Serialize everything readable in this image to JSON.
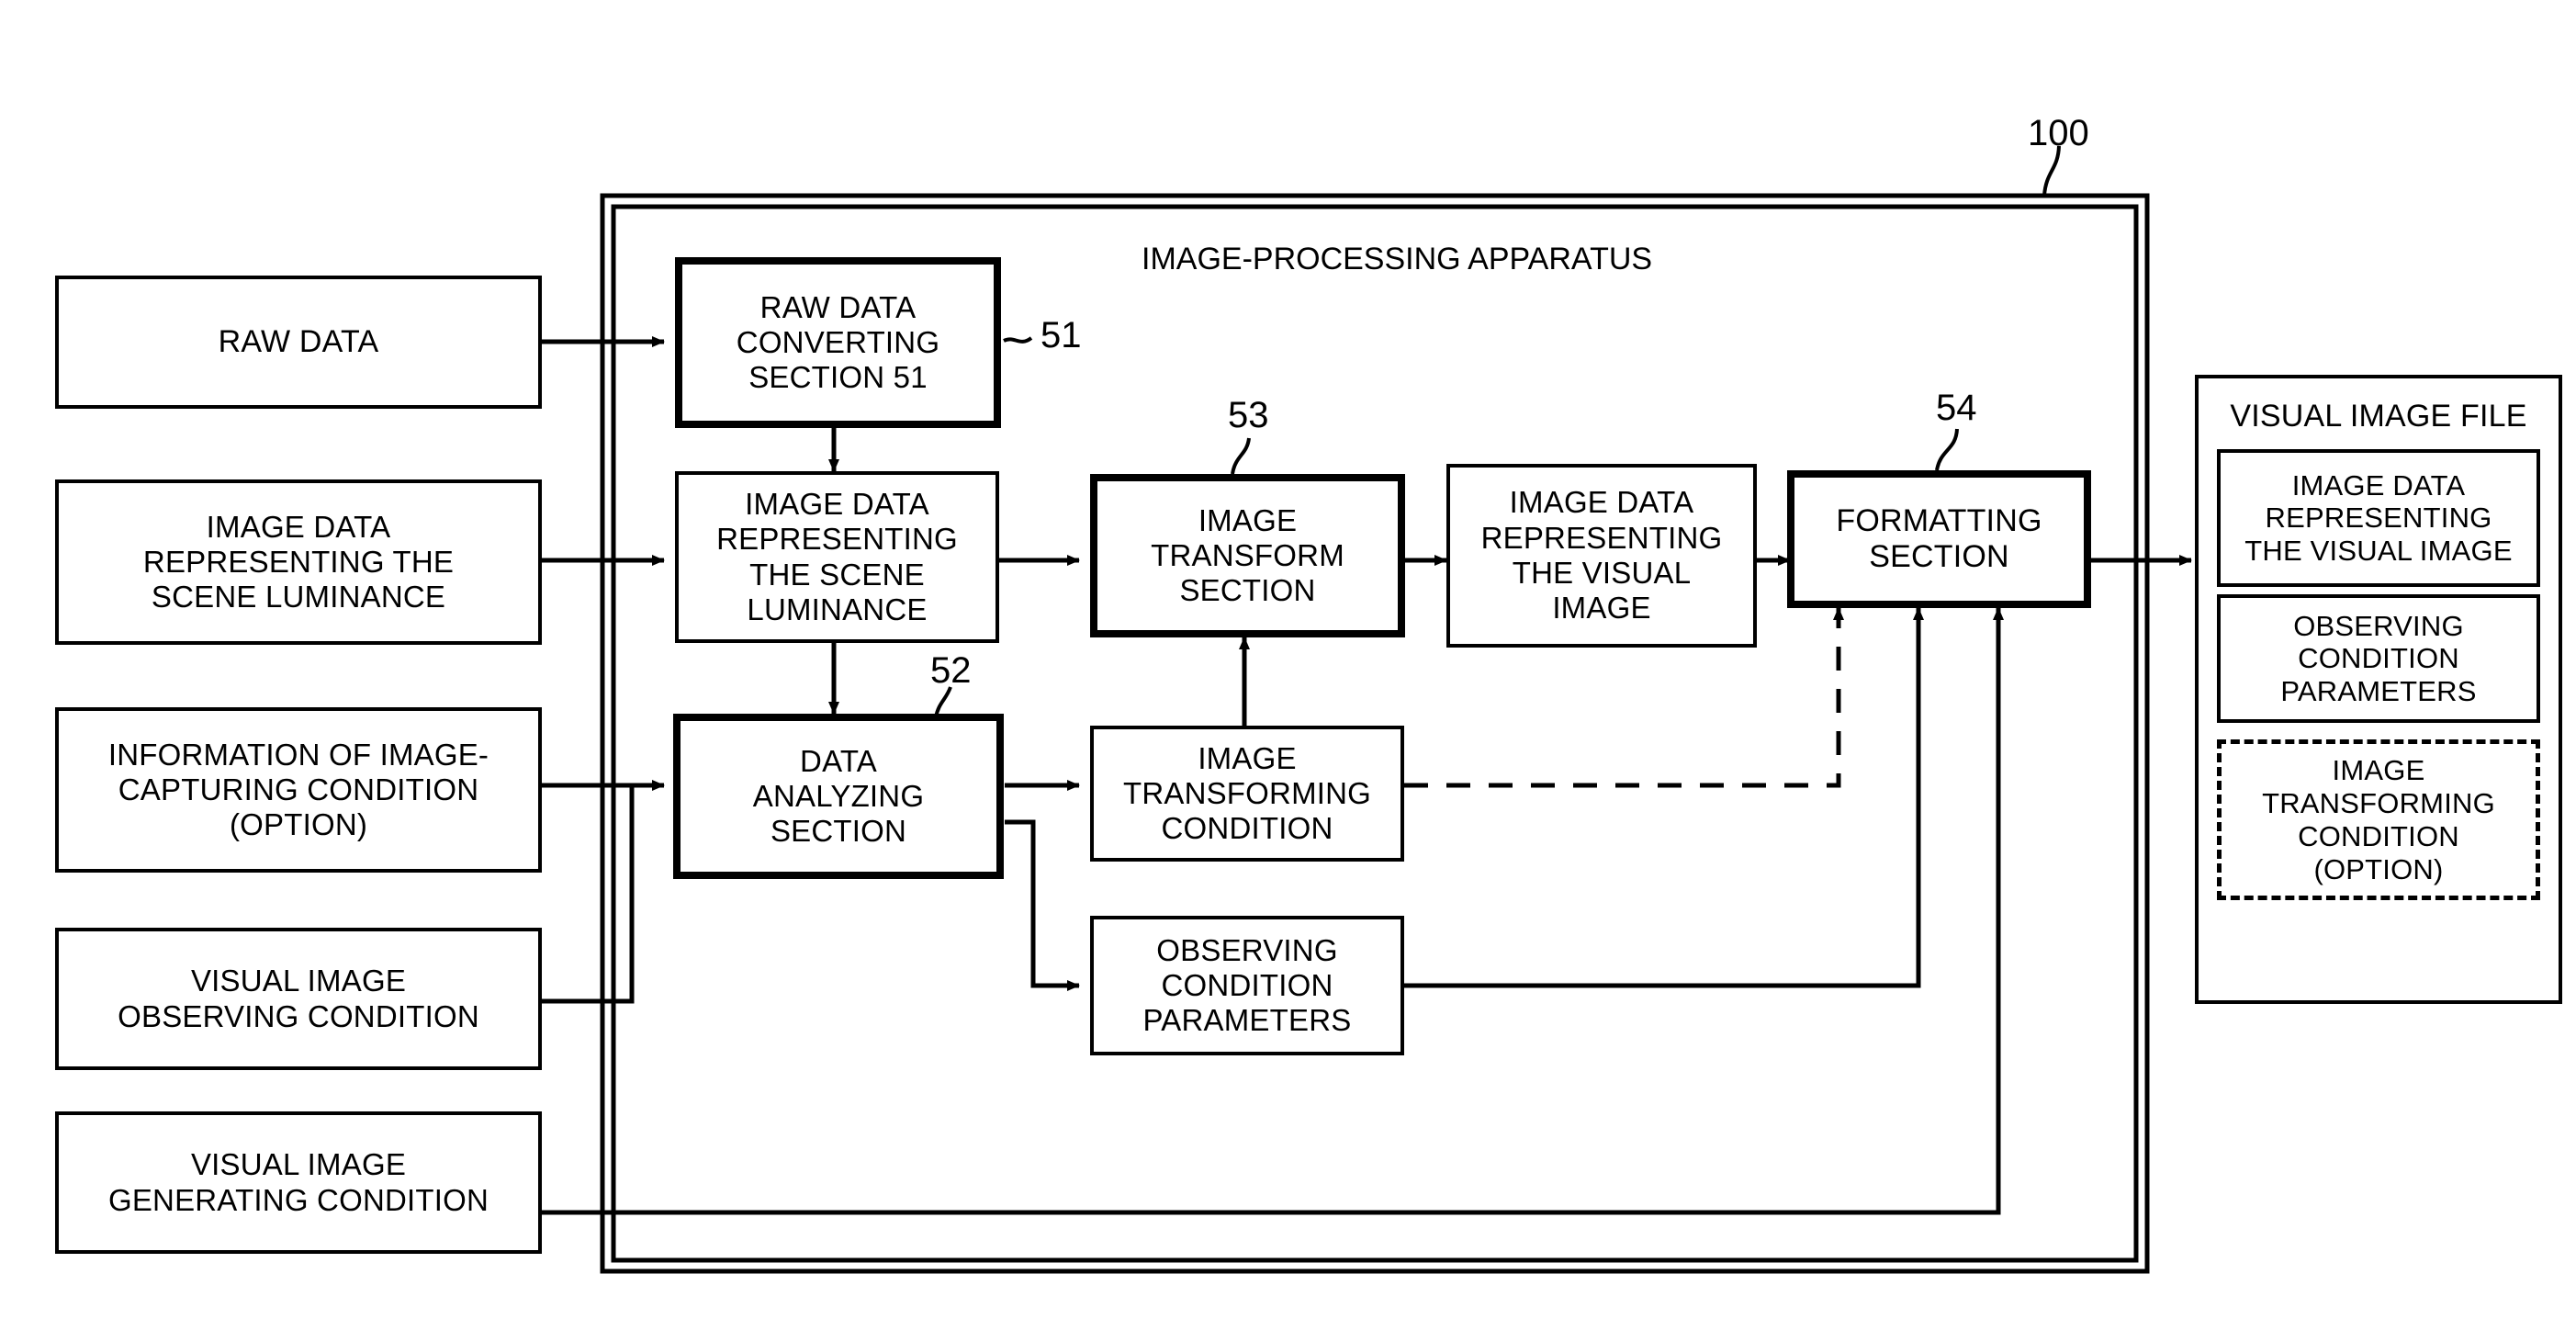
{
  "figure": {
    "apparatus_title": "IMAGE-PROCESSING APPARATUS",
    "ref_100": "100",
    "ref_51": "51",
    "ref_52": "52",
    "ref_53": "53",
    "ref_54": "54"
  },
  "inputs": {
    "raw_data": "RAW DATA",
    "image_data_scene_luminance": "IMAGE DATA\nREPRESENTING THE\nSCENE LUMINANCE",
    "image_capturing_condition": "INFORMATION OF IMAGE-\nCAPTURING CONDITION\n(OPTION)",
    "visual_image_observing_condition": "VISUAL IMAGE\nOBSERVING CONDITION",
    "visual_image_generating_condition": "VISUAL IMAGE\nGENERATING CONDITION"
  },
  "apparatus": {
    "raw_data_converting_section": "RAW DATA\nCONVERTING\nSECTION 51",
    "image_data_scene_luminance": "IMAGE DATA\nREPRESENTING\nTHE SCENE\nLUMINANCE",
    "data_analyzing_section": "DATA\nANALYZING\nSECTION",
    "image_transform_section": "IMAGE\nTRANSFORM\nSECTION",
    "image_transforming_condition": "IMAGE\nTRANSFORMING\nCONDITION",
    "observing_condition_parameters": "OBSERVING\nCONDITION\nPARAMETERS",
    "image_data_visual_image": "IMAGE DATA\nREPRESENTING\nTHE VISUAL\nIMAGE",
    "formatting_section": "FORMATTING\nSECTION"
  },
  "output_file": {
    "title": "VISUAL IMAGE FILE",
    "image_data_visual_image": "IMAGE DATA\nREPRESENTING\nTHE VISUAL IMAGE",
    "observing_condition_parameters": "OBSERVING\nCONDITION\nPARAMETERS",
    "image_transforming_condition": "IMAGE\nTRANSFORMING\nCONDITION\n(OPTION)"
  },
  "colors": {
    "ink": "#000000",
    "paper": "#ffffff"
  }
}
